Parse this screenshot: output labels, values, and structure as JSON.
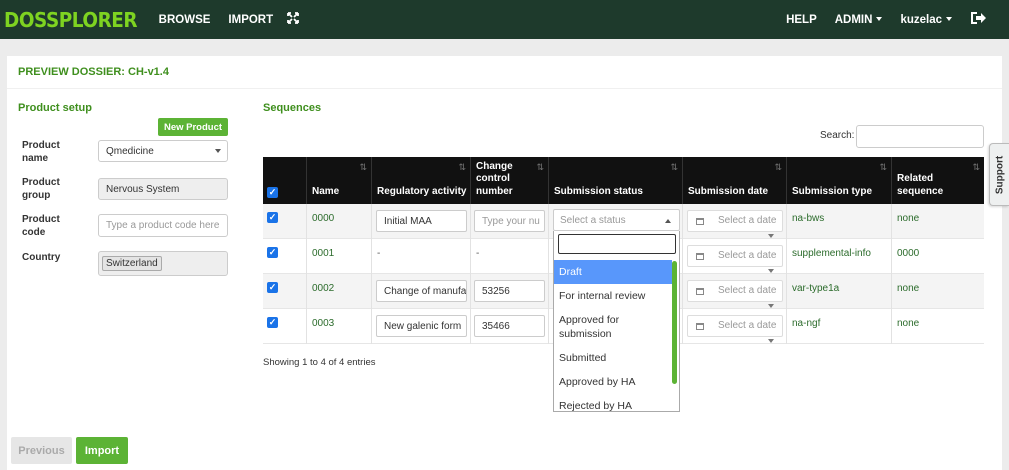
{
  "navbar": {
    "brand": "DOSSPLORER",
    "browse": "BROWSE",
    "import": "IMPORT",
    "help": "HELP",
    "admin": "ADMIN",
    "user": "kuzelac"
  },
  "panel_title": "PREVIEW DOSSIER: CH-v1.4",
  "product_setup": {
    "heading": "Product setup",
    "new_product": "New Product",
    "fields": {
      "name_label": "Product name",
      "name_value": "Qmedicine",
      "group_label": "Product group",
      "group_value": "Nervous System",
      "code_label": "Product code",
      "code_placeholder": "Type a product code here",
      "country_label": "Country",
      "country_value": "Switzerland"
    }
  },
  "sequences": {
    "heading": "Sequences",
    "search_label": "Search:",
    "columns": [
      "Name",
      "Regulatory activity",
      "Change control number",
      "Submission status",
      "Submission date",
      "Submission type",
      "Related sequence"
    ],
    "rows": [
      {
        "name": "0000",
        "activity": "Initial MAA",
        "ccn": "Type your nu",
        "ccn_placeholder": true,
        "status": "Select a status",
        "date": "Select a date",
        "type": "na-bws",
        "related": "none"
      },
      {
        "name": "0001",
        "activity": "-",
        "ccn": "-",
        "date": "Select a date",
        "type": "supplemental-info",
        "related": "0000"
      },
      {
        "name": "0002",
        "activity": "Change of manufa",
        "ccn": "53256",
        "date": "Select a date",
        "type": "var-type1a",
        "related": "none"
      },
      {
        "name": "0003",
        "activity": "New galenic form",
        "ccn": "35466",
        "date": "Select a date",
        "type": "na-ngf",
        "related": "none"
      }
    ],
    "footer": "Showing 1 to 4 of 4 entries"
  },
  "status_dropdown": {
    "options": [
      "Draft",
      "For internal review",
      "Approved for submission",
      "Submitted",
      "Approved by HA",
      "Rejected by HA"
    ],
    "selected": "Draft"
  },
  "support_tab": "Support",
  "buttons": {
    "previous": "Previous",
    "import": "Import"
  },
  "colors": {
    "navbar": "#1e3a2c",
    "brand": "#7ed321",
    "accent_green": "#5cb335",
    "heading_green": "#3f8f1e",
    "selection_blue": "#5897fb"
  }
}
